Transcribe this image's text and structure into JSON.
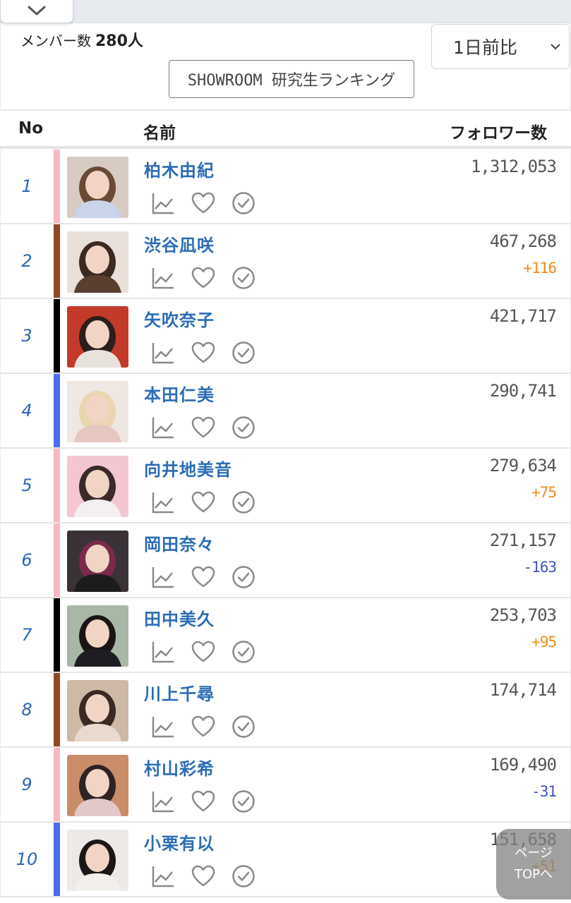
{
  "header": {
    "member_label": "メンバー数",
    "member_count": "280人",
    "compare_select": "1日前比",
    "ranking_link": "SHOWROOM 研究生ランキング"
  },
  "columns": {
    "no": "No",
    "name": "名前",
    "followers": "フォロワー数"
  },
  "icons": [
    "chevron-down-icon",
    "chart-icon",
    "heart-icon",
    "check-circle-icon"
  ],
  "rows": [
    {
      "rank": "1",
      "name": "柏木由紀",
      "followers": "1,312,053",
      "diff": "",
      "bar_color": "#f7b7c3",
      "photo_bg": "#d8cbc4",
      "photo_hair": "#6b4a35",
      "photo_cloth": "#c9d3ea"
    },
    {
      "rank": "2",
      "name": "渋谷凪咲",
      "followers": "467,268",
      "diff": "+116",
      "bar_color": "#8b4a22",
      "photo_bg": "#e9e1d9",
      "photo_hair": "#3a2a22",
      "photo_cloth": "#5a3e30"
    },
    {
      "rank": "3",
      "name": "矢吹奈子",
      "followers": "421,717",
      "diff": "",
      "bar_color": "#000000",
      "photo_bg": "#c43a2a",
      "photo_hair": "#2a1f1a",
      "photo_cloth": "#e8e2dc"
    },
    {
      "rank": "4",
      "name": "本田仁美",
      "followers": "290,741",
      "diff": "",
      "bar_color": "#4a6ef0",
      "photo_bg": "#efe7e2",
      "photo_hair": "#e9d6b0",
      "photo_cloth": "#e5c7c0"
    },
    {
      "rank": "5",
      "name": "向井地美音",
      "followers": "279,634",
      "diff": "+75",
      "bar_color": "#f7b7c3",
      "photo_bg": "#f3c6d2",
      "photo_hair": "#3a2a2a",
      "photo_cloth": "#f4f0f0"
    },
    {
      "rank": "6",
      "name": "岡田奈々",
      "followers": "271,157",
      "diff": "-163",
      "bar_color": "#f7b7c3",
      "photo_bg": "#3a3236",
      "photo_hair": "#7a2a4a",
      "photo_cloth": "#1c1c1c"
    },
    {
      "rank": "7",
      "name": "田中美久",
      "followers": "253,703",
      "diff": "+95",
      "bar_color": "#000000",
      "photo_bg": "#a9b8a6",
      "photo_hair": "#1a1414",
      "photo_cloth": "#1e1e22"
    },
    {
      "rank": "8",
      "name": "川上千尋",
      "followers": "174,714",
      "diff": "",
      "bar_color": "#8b4a22",
      "photo_bg": "#cdb9a6",
      "photo_hair": "#3a2a24",
      "photo_cloth": "#ead9cf"
    },
    {
      "rank": "9",
      "name": "村山彩希",
      "followers": "169,490",
      "diff": "-31",
      "bar_color": "#f7b7c3",
      "photo_bg": "#c98d6a",
      "photo_hair": "#2e2222",
      "photo_cloth": "#e2c8c8"
    },
    {
      "rank": "10",
      "name": "小栗有以",
      "followers": "151,658",
      "diff": "+51",
      "bar_color": "#4a6ef0",
      "photo_bg": "#ece9e6",
      "photo_hair": "#1b1717",
      "photo_cloth": "#f3f0ec"
    }
  ],
  "page_top": {
    "line1": "ページ",
    "line2": "TOPへ"
  }
}
